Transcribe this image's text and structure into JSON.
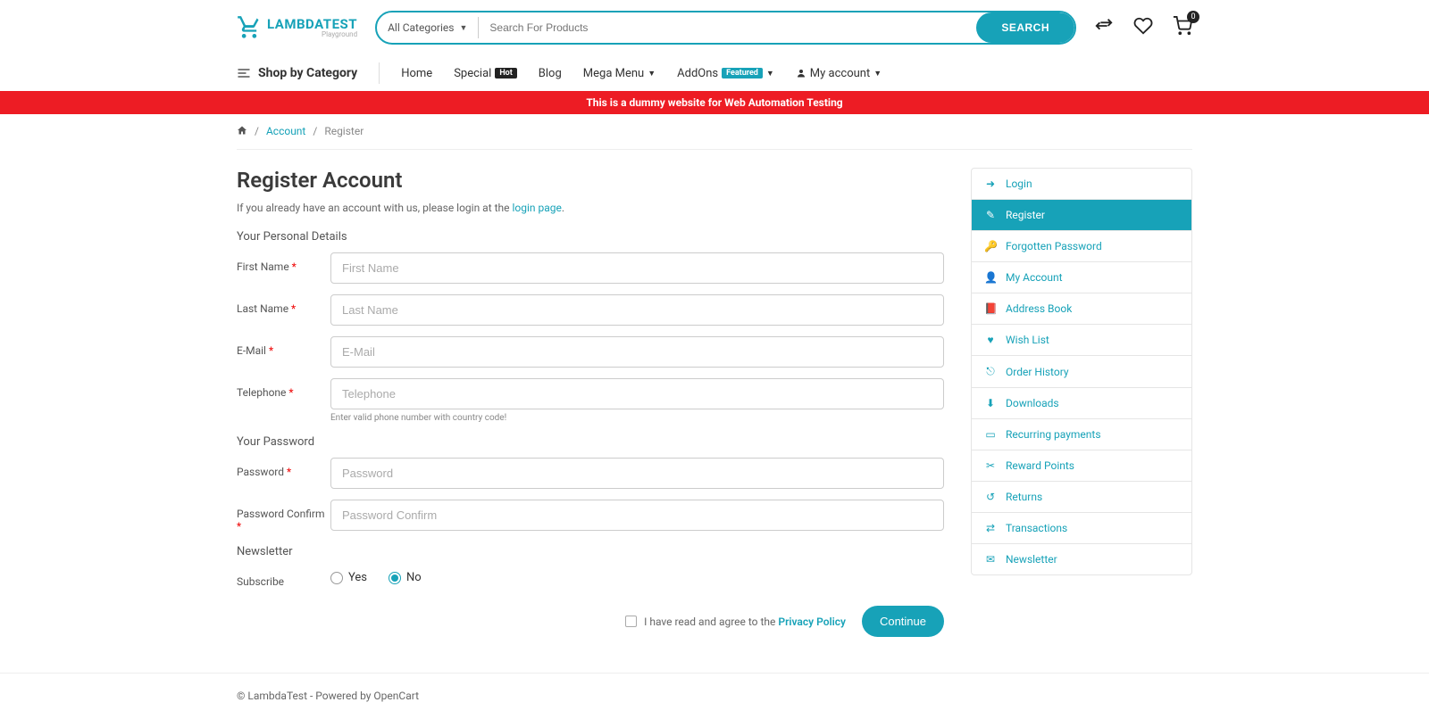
{
  "logo": {
    "main": "LAMBDATEST",
    "sub": "Playground"
  },
  "search": {
    "category": "All Categories",
    "placeholder": "Search For Products",
    "button": "SEARCH"
  },
  "cart_count": "0",
  "nav": {
    "shop_by_category": "Shop by Category",
    "items": [
      {
        "label": "Home",
        "badge": "",
        "caret": false
      },
      {
        "label": "Special",
        "badge": "Hot",
        "caret": false
      },
      {
        "label": "Blog",
        "badge": "",
        "caret": false
      },
      {
        "label": "Mega Menu",
        "badge": "",
        "caret": true
      },
      {
        "label": "AddOns",
        "badge": "Featured",
        "caret": true
      },
      {
        "label": "My account",
        "badge": "",
        "caret": true,
        "icon": true
      }
    ]
  },
  "banner": "This is a dummy website for Web Automation Testing",
  "breadcrumb": {
    "account": "Account",
    "register": "Register"
  },
  "page": {
    "title": "Register Account",
    "intro": "If you already have an account with us, please login at the ",
    "login_link": "login page",
    "section_personal": "Your Personal Details",
    "section_password": "Your Password",
    "section_newsletter": "Newsletter",
    "labels": {
      "first_name": "First Name",
      "last_name": "Last Name",
      "email": "E-Mail",
      "telephone": "Telephone",
      "phone_help": "Enter valid phone number with country code!",
      "password": "Password",
      "password_confirm": "Password Confirm",
      "subscribe": "Subscribe",
      "yes": "Yes",
      "no": "No"
    },
    "placeholders": {
      "first_name": "First Name",
      "last_name": "Last Name",
      "email": "E-Mail",
      "telephone": "Telephone",
      "password": "Password",
      "password_confirm": "Password Confirm"
    },
    "agree_text": "I have read and agree to the ",
    "privacy_link": "Privacy Policy",
    "continue": "Continue"
  },
  "sidebar": [
    {
      "label": "Login",
      "icon": "login"
    },
    {
      "label": "Register",
      "icon": "register",
      "active": true
    },
    {
      "label": "Forgotten Password",
      "icon": "key"
    },
    {
      "label": "My Account",
      "icon": "user"
    },
    {
      "label": "Address Book",
      "icon": "book"
    },
    {
      "label": "Wish List",
      "icon": "heart"
    },
    {
      "label": "Order History",
      "icon": "history"
    },
    {
      "label": "Downloads",
      "icon": "download"
    },
    {
      "label": "Recurring payments",
      "icon": "card"
    },
    {
      "label": "Reward Points",
      "icon": "reward"
    },
    {
      "label": "Returns",
      "icon": "return"
    },
    {
      "label": "Transactions",
      "icon": "exchange"
    },
    {
      "label": "Newsletter",
      "icon": "envelope"
    }
  ],
  "footer": "© LambdaTest - Powered by OpenCart"
}
